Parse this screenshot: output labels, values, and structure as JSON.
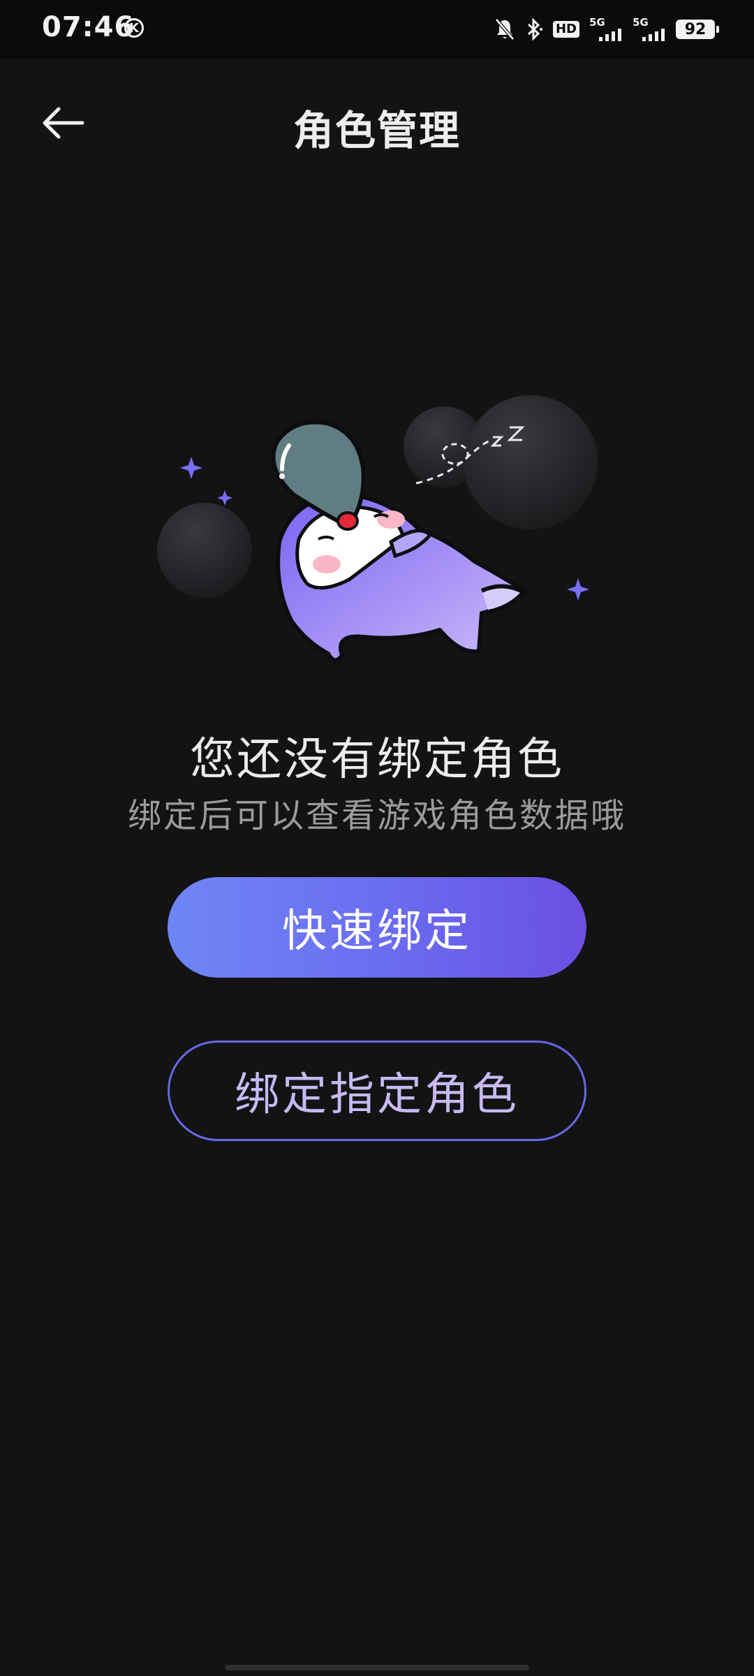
{
  "status_bar": {
    "time": "07:46",
    "k_badge": "K",
    "hd_label": "HD",
    "signal_1_label": "5G",
    "signal_2_label": "5G",
    "battery_level": "92",
    "icons": [
      "mute-bell-icon",
      "bluetooth-icon",
      "hd-voice-icon",
      "signal-5g-icon",
      "signal-5g-icon",
      "battery-icon"
    ]
  },
  "header": {
    "title": "角色管理",
    "back_icon": "arrow-left-icon"
  },
  "empty_state": {
    "title": "您还没有绑定角色",
    "subtitle": "绑定后可以查看游戏角色数据哦"
  },
  "actions": {
    "quick_bind_label": "快速绑定",
    "bind_specific_label": "绑定指定角色"
  },
  "colors": {
    "background": "#131314",
    "accent_start": "#6f86f6",
    "accent_end": "#6b4fe2",
    "outline": "#6a66e6",
    "secondary_text": "#c7b9f3"
  }
}
